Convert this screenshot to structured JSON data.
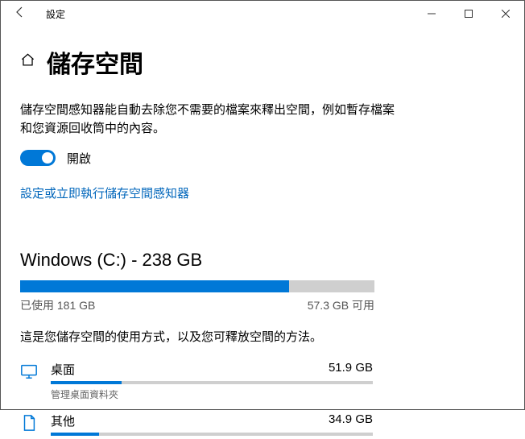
{
  "window": {
    "title": "設定"
  },
  "page": {
    "heading": "儲存空間",
    "description": "儲存空間感知器能自動去除您不需要的檔案來釋出空間，例如暫存檔案和您資源回收筒中的內容。",
    "toggle_label": "開啟",
    "config_link": "設定或立即執行儲存空間感知器"
  },
  "drive": {
    "heading": "Windows (C:) - 238 GB",
    "used_label": "已使用 181 GB",
    "free_label": "57.3 GB 可用",
    "used_pct": 76,
    "usage_desc": "這是您儲存空間的使用方式，以及您可釋放空間的方法。"
  },
  "chart_data": {
    "type": "bar",
    "title": "Windows (C:) - 238 GB",
    "total_gb": 238,
    "used_gb": 181,
    "free_gb": 57.3,
    "categories": [
      {
        "name": "桌面",
        "value_gb": 51.9,
        "pct_of_drive": 22,
        "subtext": "管理桌面資料夾"
      },
      {
        "name": "其他",
        "value_gb": 34.9,
        "pct_of_drive": 15,
        "subtext": ""
      }
    ],
    "xlabel": "",
    "ylabel": "GB"
  },
  "categories": [
    {
      "name": "桌面",
      "size": "51.9 GB",
      "sub": "管理桌面資料夾",
      "pct": 22
    },
    {
      "name": "其他",
      "size": "34.9 GB",
      "sub": "",
      "pct": 15
    }
  ]
}
